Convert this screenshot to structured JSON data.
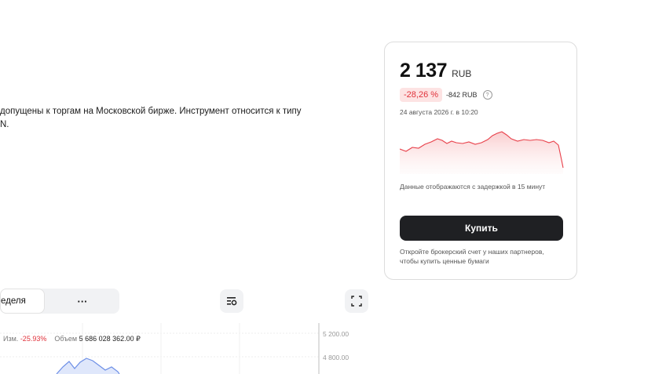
{
  "description": {
    "line1": "допущены к торгам на Московской бирже. Инструмент относится к типу",
    "line2": "N."
  },
  "quote_card": {
    "price": "2 137",
    "currency": "RUB",
    "change_percent": "-28,26 %",
    "change_abs": "-842 RUB",
    "help_icon": "?",
    "date": "24 августа 2026 г. в 10:20",
    "delay_note": "Данные отображаются с задержкой в 15 минут",
    "buy_label": "Купить",
    "partners_note": "Откройте брокерский счет у наших партнеров, чтобы купить ценные бумаги",
    "sparkline_color": "#e8404a"
  },
  "period_tabs": {
    "active_label": "еделя",
    "more_label": "···"
  },
  "toolbar": {
    "indicators_icon": "indicators-settings-icon",
    "fullscreen_icon": "fullscreen-icon"
  },
  "chart_legend": {
    "change_label": "Изм.",
    "change_value": "-25.93%",
    "volume_label": "Объем",
    "volume_value": "5 686 028 362.00 ₽"
  },
  "chart_data": {
    "type": "area",
    "y_ticks": [
      "5 200.00",
      "4 800.00"
    ],
    "series_color": "#6d8fe6"
  }
}
